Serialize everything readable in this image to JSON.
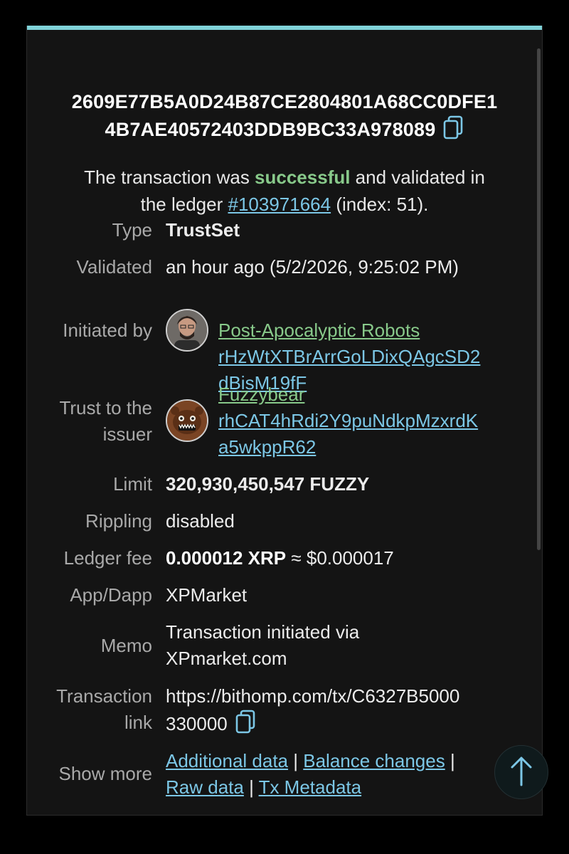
{
  "tx": {
    "hash_line1": "2609E77B5A0D24B87CE2804801A68CC0DFE1",
    "hash_line2": "4B7AE40572403DDB9BC33A978089",
    "status_pre": "The transaction was ",
    "status_word": "successful",
    "status_mid": " and validated in",
    "status_pre2": "the ledger ",
    "ledger_link": "#103971664",
    "status_post": " (index: 51)."
  },
  "fields": {
    "type_label": "Type",
    "type_value": "TrustSet",
    "validated_label": "Validated",
    "validated_value": "an hour ago (5/2/2026, 9:25:02 PM)",
    "initiated_label": "Initiated by",
    "initiator_name": "Post-Apocalyptic Robots",
    "initiator_addr1": "rHzWtXTBrArrGoLDixQAgcSD2",
    "initiator_addr2": "dBisM19fF",
    "trust_label1": "Trust to the",
    "trust_label2": "issuer",
    "issuer_name": "Fuzzybear",
    "issuer_addr1": "rhCAT4hRdi2Y9puNdkpMzxrdK",
    "issuer_addr2": "a5wkppR62",
    "limit_label": "Limit",
    "limit_value": "320,930,450,547 FUZZY",
    "rippling_label": "Rippling",
    "rippling_value": "disabled",
    "fee_label": "Ledger fee",
    "fee_xrp": "0.000012 XRP",
    "fee_usd": " ≈ $0.000017",
    "app_label": "App/Dapp",
    "app_value": "XPMarket",
    "memo_label": "Memo",
    "memo_line1": "Transaction initiated via",
    "memo_line2": "XPmarket.com",
    "link_label1": "Transaction",
    "link_label2": "link",
    "link_line1": "https://bithomp.com/tx/C6327B5000",
    "link_line2": "330000",
    "more_label": "Show more",
    "more_additional": "Additional data",
    "more_balance": "Balance changes",
    "more_raw": "Raw data",
    "more_meta": "Tx Metadata",
    "separator": " | "
  },
  "icons": {
    "copy": "copy-icon",
    "scroll_top": "arrow-up-icon"
  },
  "colors": {
    "accent_bar": "#7fd2d8",
    "success_green": "#88c98a",
    "link_blue": "#7cc7e6"
  }
}
